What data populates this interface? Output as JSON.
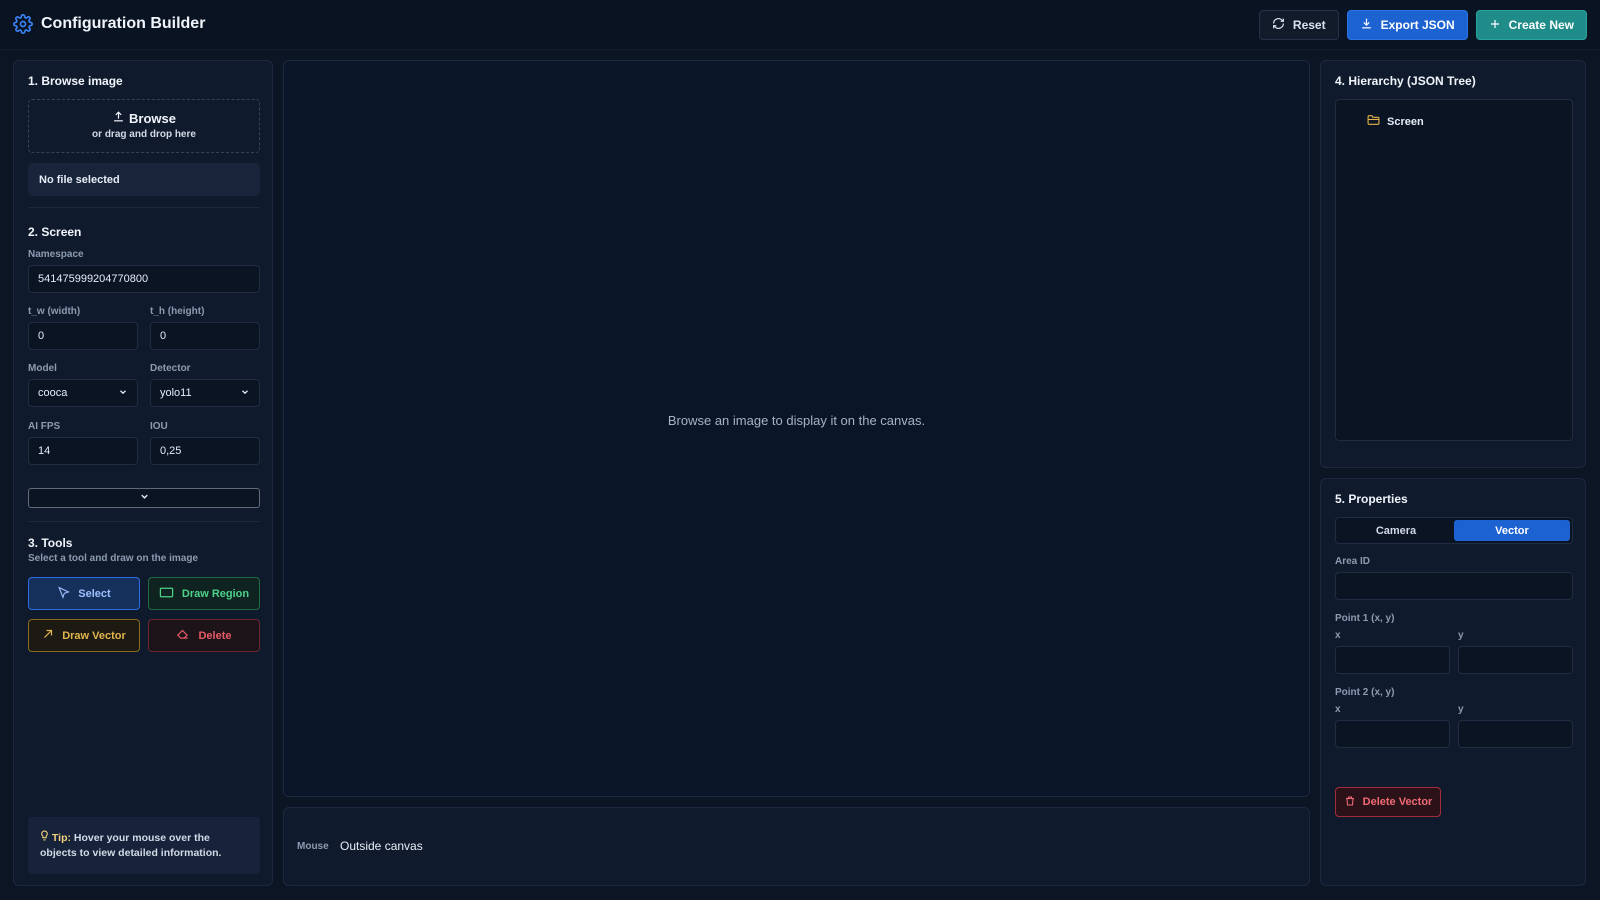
{
  "app": {
    "title": "Configuration Builder",
    "icon": "gear-icon",
    "accent": "#1d62d1"
  },
  "toolbar": {
    "reset_label": "Reset",
    "export_label": "Export JSON",
    "create_label": "Create New"
  },
  "browse": {
    "section_title": "1. Browse image",
    "button_label": "Browse",
    "dropzone_hint": "or drag and drop here",
    "file_status": "No file selected"
  },
  "screen": {
    "section_title": "2. Screen",
    "namespace_label": "Namespace",
    "namespace_value": "541475999204770800",
    "width_label": "t_w (width)",
    "width_value": "0",
    "height_label": "t_h (height)",
    "height_value": "0",
    "model_label": "Model",
    "model_value": "cooca",
    "detector_label": "Detector",
    "detector_value": "yolo11",
    "fps_label": "AI FPS",
    "fps_value": "14",
    "iou_label": "IOU",
    "iou_value": "0,25"
  },
  "tools": {
    "section_title": "3. Tools",
    "hint": "Select a tool and draw on the image",
    "select_label": "Select",
    "region_label": "Draw Region",
    "vector_label": "Draw Vector",
    "delete_label": "Delete",
    "active_tool": "Select"
  },
  "tip": {
    "label": "Tip:",
    "text": "Hover your mouse over the objects to view detailed information."
  },
  "canvas": {
    "empty_message": "Browse an image to display it on the canvas."
  },
  "status": {
    "mouse_label": "Mouse",
    "mouse_value": "Outside canvas"
  },
  "hierarchy": {
    "section_title": "4. Hierarchy (JSON Tree)",
    "nodes": [
      {
        "label": "Screen",
        "icon": "folder-icon"
      }
    ]
  },
  "properties": {
    "section_title": "5. Properties",
    "tabs": [
      {
        "label": "Camera"
      },
      {
        "label": "Vector"
      }
    ],
    "active_tab": "Vector",
    "area_id_label": "Area ID",
    "area_id_value": "",
    "point1_label": "Point 1 (x, y)",
    "point2_label": "Point 2 (x, y)",
    "x_label": "x",
    "y_label": "y",
    "delete_label": "Delete Vector"
  }
}
